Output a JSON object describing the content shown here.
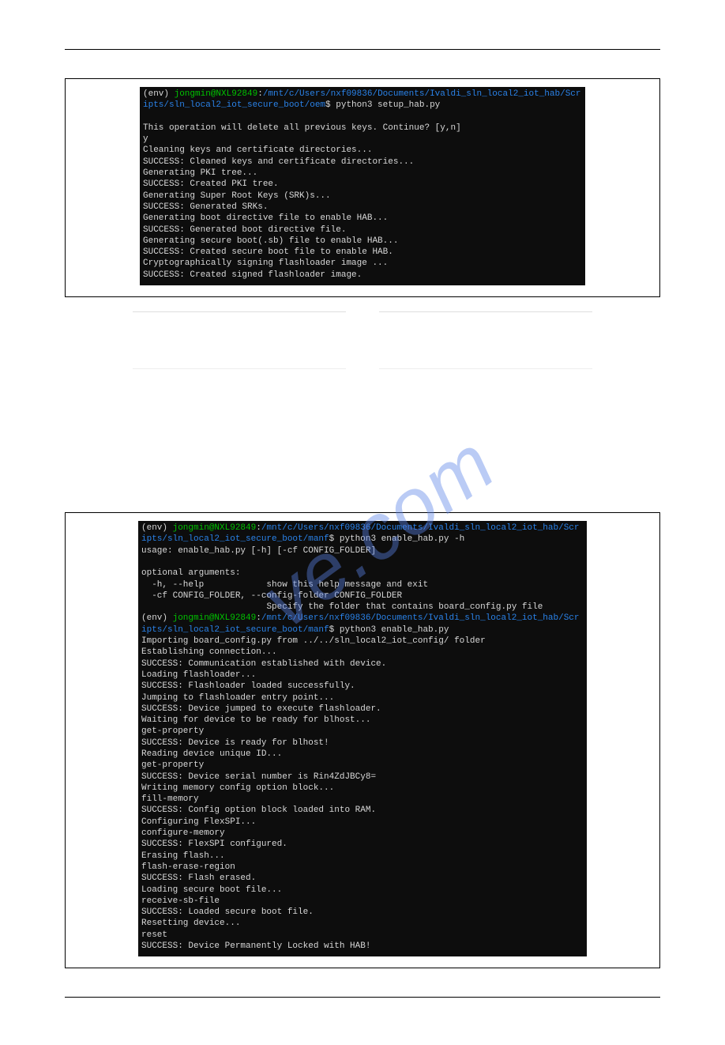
{
  "watermark": {
    "text": "ve.com"
  },
  "figure1": {
    "prompt1": {
      "env": "(env) ",
      "userhost": "jongmin@NXL92849",
      "colon": ":",
      "path": "/mnt/c/Users/nxf09836/Documents/Ivaldi_sln_local2_iot_hab/Scripts/sln_local2_iot_secure_boot/oem",
      "dollar": "$ ",
      "command": "python3 setup_hab.py"
    },
    "body": "\nThis operation will delete all previous keys. Continue? [y,n]\ny\nCleaning keys and certificate directories...\nSUCCESS: Cleaned keys and certificate directories...\nGenerating PKI tree...\nSUCCESS: Created PKI tree.\nGenerating Super Root Keys (SRK)s...\nSUCCESS: Generated SRKs.\nGenerating boot directive file to enable HAB...\nSUCCESS: Generated boot directive file.\nGenerating secure boot(.sb) file to enable HAB...\nSUCCESS: Created secure boot file to enable HAB.\nCryptographically signing flashloader image ...\nSUCCESS: Created signed flashloader image."
  },
  "figure2": {
    "prompt1": {
      "env": "(env) ",
      "userhost": "jongmin@NXL92849",
      "colon": ":",
      "path": "/mnt/c/Users/nxf09836/Documents/Ivaldi_sln_local2_iot_hab/Scripts/sln_local2_iot_secure_boot/manf",
      "dollar": "$ ",
      "command": "python3 enable_hab.py -h"
    },
    "usage": "usage: enable_hab.py [-h] [-cf CONFIG_FOLDER]",
    "optargs_header": "optional arguments:",
    "optargs_lines": "  -h, --help            show this help message and exit\n  -cf CONFIG_FOLDER, --config-folder CONFIG_FOLDER\n                        Specify the folder that contains board_config.py file",
    "prompt2": {
      "env": "(env) ",
      "userhost": "jongmin@NXL92849",
      "colon": ":",
      "path": "/mnt/c/Users/nxf09836/Documents/Ivaldi_sln_local2_iot_hab/Scripts/sln_local2_iot_secure_boot/manf",
      "dollar": "$ ",
      "command": "python3 enable_hab.py"
    },
    "body": "Importing board_config.py from ../../sln_local2_iot_config/ folder\nEstablishing connection...\nSUCCESS: Communication established with device.\nLoading flashloader...\nSUCCESS: Flashloader loaded successfully.\nJumping to flashloader entry point...\nSUCCESS: Device jumped to execute flashloader.\nWaiting for device to be ready for blhost...\nget-property\nSUCCESS: Device is ready for blhost!\nReading device unique ID...\nget-property\nSUCCESS: Device serial number is Rin4ZdJBCy8=\nWriting memory config option block...\nfill-memory\nSUCCESS: Config option block loaded into RAM.\nConfiguring FlexSPI...\nconfigure-memory\nSUCCESS: FlexSPI configured.\nErasing flash...\nflash-erase-region\nSUCCESS: Flash erased.\nLoading secure boot file...\nreceive-sb-file\nSUCCESS: Loaded secure boot file.\nResetting device...\nreset\nSUCCESS: Device Permanently Locked with HAB!"
  }
}
